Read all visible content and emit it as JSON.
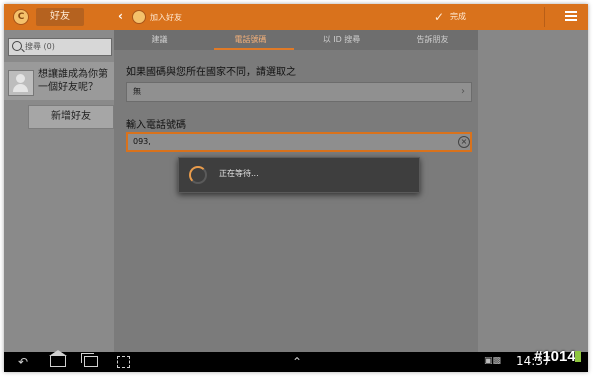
{
  "left": {
    "tab_label": "好友",
    "search_placeholder": "搜尋 (0)",
    "suggestion_text": "想讓誰成為你第一個好友呢？",
    "add_button": "新增好友"
  },
  "main": {
    "title": "加入好友",
    "done_label": "完成",
    "tabs": [
      "建議",
      "電話號碼",
      "以 ID 搜尋",
      "告訴朋友"
    ],
    "active_tab": 1,
    "country_prompt": "如果國碼與您所在國家不同，請選取之",
    "country_value": "無",
    "phone_label": "輸入電話號碼",
    "phone_value": "093,"
  },
  "dialog": {
    "message": "正在等待..."
  },
  "statusbar": {
    "time": "14:37"
  },
  "watermark": "#1014",
  "colors": {
    "accent": "#d9721c",
    "active_tab_text": "#f7b27a"
  },
  "icons": [
    "back-icon",
    "home-icon",
    "recent-apps-icon",
    "screenshot-icon",
    "up-chevron-icon",
    "menu-icon",
    "search-icon",
    "clear-icon",
    "spinner-icon",
    "battery-icon"
  ]
}
